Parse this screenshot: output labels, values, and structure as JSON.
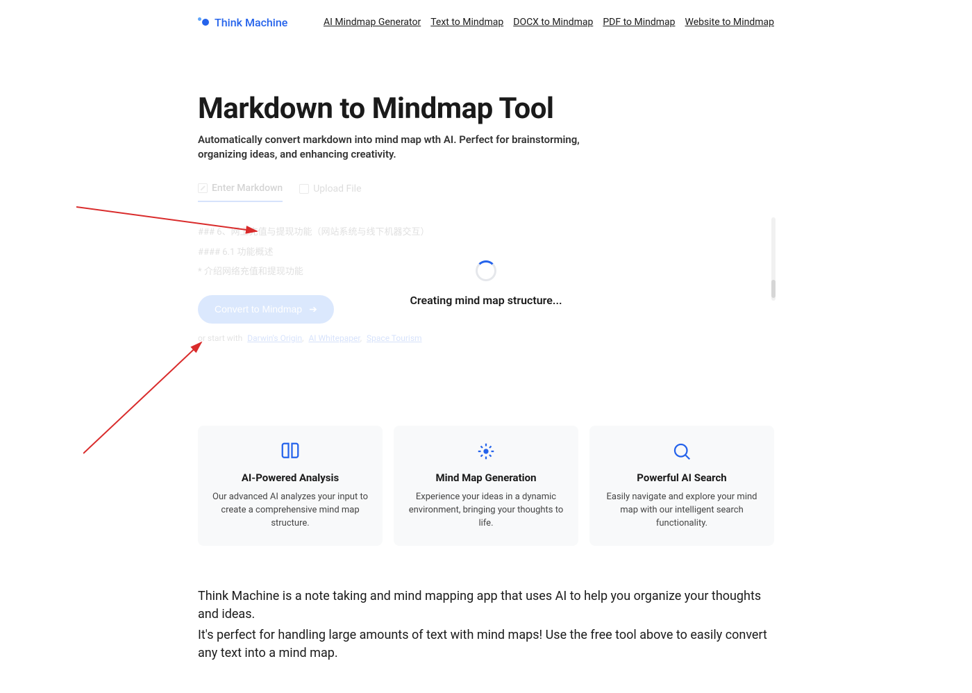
{
  "brand": {
    "name": "Think Machine"
  },
  "nav": {
    "items": [
      "AI Mindmap Generator",
      "Text to Mindmap",
      "DOCX to Mindmap",
      "PDF to Mindmap",
      "Website to Mindmap"
    ]
  },
  "hero": {
    "title": "Markdown to Mindmap Tool",
    "subtitle": "Automatically convert markdown into mind map wth AI. Perfect for brainstorming, organizing ideas, and enhancing creativity."
  },
  "editor": {
    "tabs": {
      "enter": "Enter Markdown",
      "upload": "Upload File"
    },
    "lines": [
      "### 6、网上充值与提现功能（网站系统与线下机器交互）",
      "#### 6.1 功能概述",
      "* 介绍网络充值和提现功能"
    ],
    "convert_label": "Convert to Mindmap",
    "examples_label": "or start with",
    "example_links": [
      "Darwin's Origin",
      "AI Whitepaper",
      "Space Tourism"
    ]
  },
  "loading": {
    "text": "Creating mind map structure..."
  },
  "features": [
    {
      "icon": "book",
      "title": "AI-Powered Analysis",
      "desc": "Our advanced AI analyzes your input to create a comprehensive mind map structure."
    },
    {
      "icon": "expand",
      "title": "Mind Map Generation",
      "desc": "Experience your ideas in a dynamic environment, bringing your thoughts to life."
    },
    {
      "icon": "search",
      "title": "Powerful AI Search",
      "desc": "Easily navigate and explore your mind map with our intelligent search functionality."
    }
  ],
  "body": {
    "p1": "Think Machine is a note taking and mind mapping app that uses AI to help you organize your thoughts and ideas.",
    "p2": "It's perfect for handling large amounts of text with mind maps! Use the free tool above to easily convert any text into a mind map."
  }
}
